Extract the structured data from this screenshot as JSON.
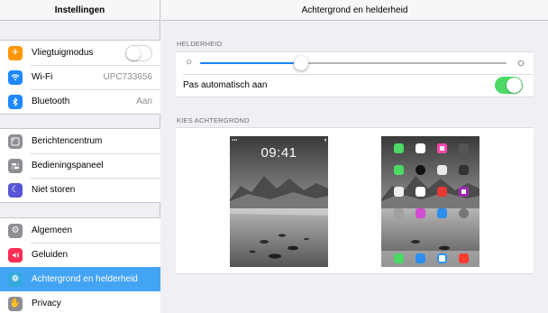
{
  "sidebar": {
    "title": "Instellingen",
    "groups": [
      {
        "items": [
          {
            "label": "Vliegtuigmodus",
            "icon": "airplane-icon",
            "color": "#ff9500",
            "control": "toggle-off"
          },
          {
            "label": "Wi-Fi",
            "icon": "wifi-icon",
            "color": "#1e88ff",
            "value": "UPC733656"
          },
          {
            "label": "Bluetooth",
            "icon": "bluetooth-icon",
            "color": "#1e88ff",
            "value": "Aan"
          }
        ]
      },
      {
        "items": [
          {
            "label": "Berichtencentrum",
            "icon": "notification-center-icon",
            "color": "#8e8e93"
          },
          {
            "label": "Bedieningspaneel",
            "icon": "control-center-icon",
            "color": "#8e8e93"
          },
          {
            "label": "Niet storen",
            "icon": "moon-icon",
            "color": "#5856d6"
          }
        ]
      },
      {
        "items": [
          {
            "label": "Algemeen",
            "icon": "gear-icon",
            "color": "#8e8e93"
          },
          {
            "label": "Geluiden",
            "icon": "sound-icon",
            "color": "#ff2d55"
          },
          {
            "label": "Achtergrond en helderheid",
            "icon": "wallpaper-icon",
            "color": "#34aadc",
            "selected": true
          },
          {
            "label": "Privacy",
            "icon": "hand-icon",
            "color": "#8e8e93"
          }
        ]
      }
    ]
  },
  "main": {
    "title": "Achtergrond en helderheid",
    "brightness": {
      "section_title": "HELDERHEID",
      "level": 0.33,
      "auto_label": "Pas automatisch aan",
      "auto_enabled": true
    },
    "wallpaper": {
      "section_title": "KIES ACHTERGROND",
      "lock_time": "09:41"
    }
  },
  "colors": {
    "accent": "#1a84f6",
    "selection": "#44a4f4",
    "toggle_on": "#4cd964"
  }
}
